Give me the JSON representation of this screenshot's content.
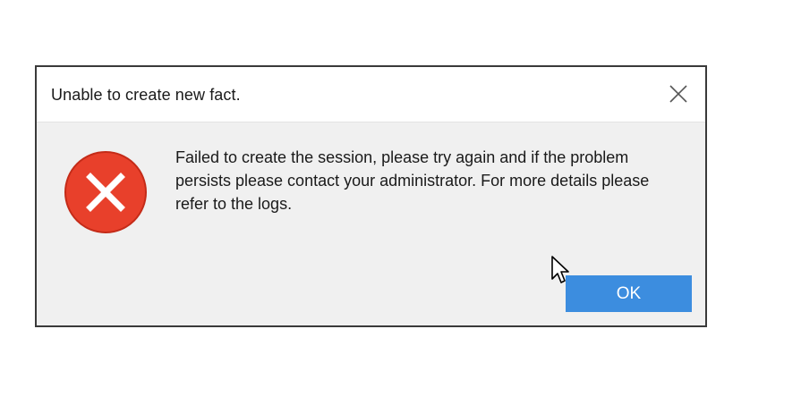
{
  "dialog": {
    "title": "Unable to create new fact.",
    "message": "Failed to create the session, please try again and if the problem persists please contact your administrator. For more details please refer to the logs.",
    "ok_label": "OK",
    "icons": {
      "close": "close-icon",
      "error": "error-icon",
      "cursor": "mouse-pointer-icon"
    },
    "colors": {
      "error_red": "#e8402b",
      "ok_blue": "#3c8ddf",
      "body_bg": "#f0f0f0"
    }
  }
}
